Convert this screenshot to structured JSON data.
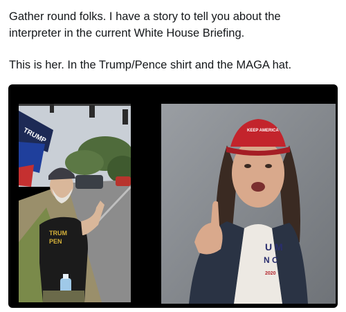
{
  "tweet": {
    "line1": "Gather round folks. I have a story to tell you about the",
    "line2": "interpreter in the current White House Briefing.",
    "line3": "This is her. In the Trump/Pence shirt and the MAGA hat."
  },
  "media": {
    "left_photo": {
      "flag_text": "TRUMP",
      "shirt_text_1": "TRUM",
      "shirt_text_2": "PEN"
    },
    "right_photo": {
      "hat_text": "KEEP AMERICA",
      "shirt_text_1": "U M",
      "shirt_text_2": "N C",
      "shirt_text_3": "2020"
    }
  }
}
